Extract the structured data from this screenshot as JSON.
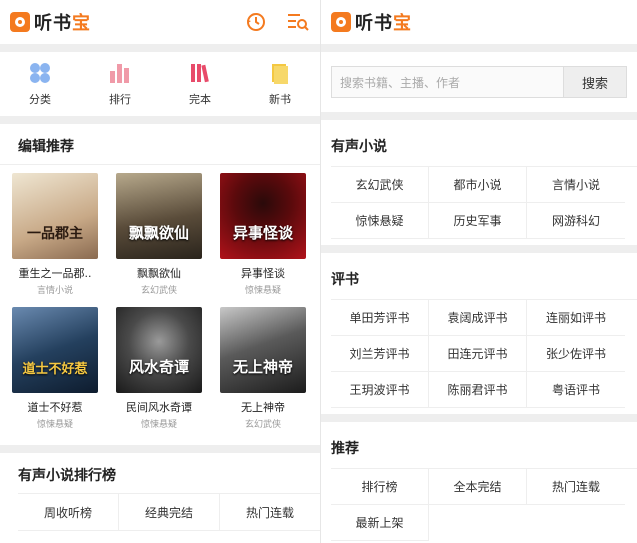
{
  "app": {
    "logo_main": "听书",
    "logo_accent": "宝"
  },
  "left": {
    "nav": [
      {
        "label": "分类",
        "icon": "category-icon"
      },
      {
        "label": "排行",
        "icon": "ranking-icon"
      },
      {
        "label": "完本",
        "icon": "books-icon"
      },
      {
        "label": "新书",
        "icon": "new-book-icon"
      }
    ],
    "editor_section": {
      "title": "编辑推荐"
    },
    "books": [
      {
        "title": "重生之一品郡..",
        "category": "言情小说",
        "cover_text": "一品郡主",
        "cover_color": "#d8c7a8"
      },
      {
        "title": "飘飘欲仙",
        "category": "玄幻武侠",
        "cover_text": "飘飘欲仙",
        "cover_color": "#4a4034"
      },
      {
        "title": "异事怪谈",
        "category": "惊悚悬疑",
        "cover_text": "异事怪谈",
        "cover_color": "#7a0f12"
      },
      {
        "title": "道士不好惹",
        "category": "惊悚悬疑",
        "cover_text": "道士不好惹",
        "cover_color": "#1f3550"
      },
      {
        "title": "民间风水奇谭",
        "category": "惊悚悬疑",
        "cover_text": "风水奇谭",
        "cover_color": "#3a3a3a"
      },
      {
        "title": "无上神帝",
        "category": "玄幻武侠",
        "cover_text": "无上神帝",
        "cover_color": "#2a2a2a"
      }
    ],
    "ranking_section": {
      "title": "有声小说排行榜",
      "tabs": [
        "周收听榜",
        "经典完结",
        "热门连载"
      ]
    }
  },
  "right": {
    "search": {
      "placeholder": "搜索书籍、主播、作者",
      "button": "搜索"
    },
    "sections": [
      {
        "title": "有声小说",
        "items": [
          "玄幻武侠",
          "都市小说",
          "言情小说",
          "惊悚悬疑",
          "历史军事",
          "网游科幻"
        ]
      },
      {
        "title": "评书",
        "items": [
          "单田芳评书",
          "袁阔成评书",
          "连丽如评书",
          "刘兰芳评书",
          "田连元评书",
          "张少佐评书",
          "王玥波评书",
          "陈丽君评书",
          "粤语评书"
        ]
      },
      {
        "title": "推荐",
        "items": [
          "排行榜",
          "全本完结",
          "热门连载",
          "最新上架"
        ]
      }
    ]
  },
  "colors": {
    "accent": "#f47a1f",
    "divider": "#eeeeee"
  }
}
